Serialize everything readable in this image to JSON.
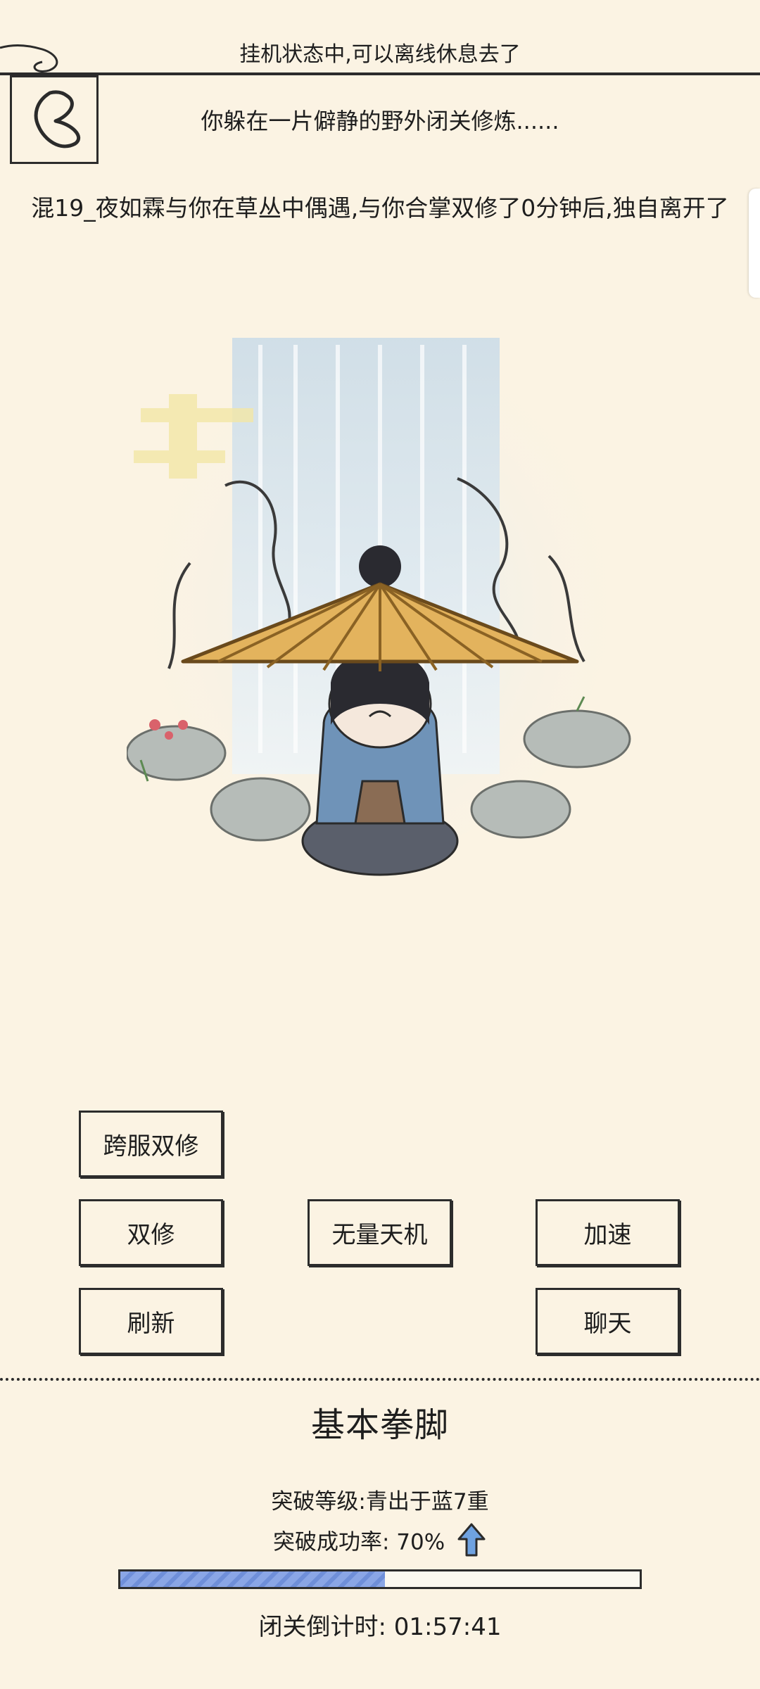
{
  "header": {
    "status": "挂机状态中,可以离线休息去了",
    "subtitle": "你躲在一片僻静的野外闭关修炼......",
    "message": "混19_夜如霖与你在草丛中偶遇,与你合掌双修了0分钟后,独自离开了"
  },
  "buttons": {
    "cross_server": "跨服双修",
    "dual": "双修",
    "tianji": "无量天机",
    "speed": "加速",
    "refresh": "刷新",
    "chat": "聊天"
  },
  "skill": {
    "title": "基本拳脚",
    "level": "突破等级:青出于蓝7重",
    "rate": "突破成功率: 70%",
    "progress": 0.51,
    "countdown": "闭关倒计时: 01:57:41"
  },
  "colors": {
    "background": "#fbf3e3",
    "progress_fill": "#7b97dd",
    "ink": "#2c2c2c"
  },
  "icons": {
    "back": "back-arrow-icon",
    "rate_up": "up-arrow-icon"
  }
}
